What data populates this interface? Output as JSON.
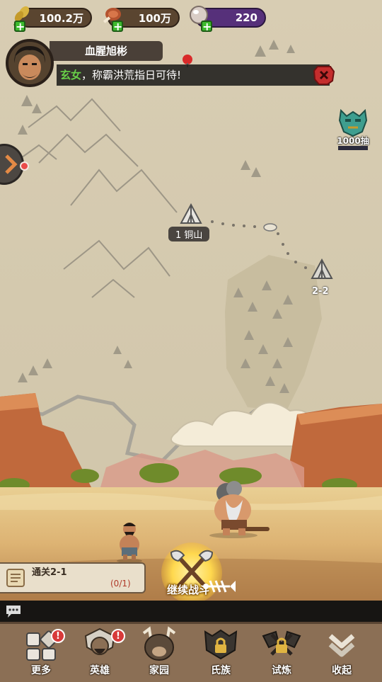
{
  "resources": [
    {
      "icon": "wheat-icon",
      "value": "100.2万"
    },
    {
      "icon": "meat-icon",
      "value": "100万"
    },
    {
      "icon": "gem-icon",
      "value": "220"
    }
  ],
  "profile": {
    "name": "血腥旭彬",
    "announcement_highlight": "玄女",
    "announcement_text": "，称霸洪荒指日可待!"
  },
  "lottery": {
    "label": "1000抽"
  },
  "map": {
    "nodes": [
      {
        "label": "1 铜山"
      },
      {
        "label": "2-2"
      }
    ]
  },
  "quest": {
    "title": "通关2-1",
    "progress": "(0/1)"
  },
  "battle": {
    "label": "继续战斗"
  },
  "nav": [
    {
      "label": "更多",
      "icon": "more-icon",
      "badge": "!"
    },
    {
      "label": "英雄",
      "icon": "hero-icon",
      "badge": "!"
    },
    {
      "label": "家园",
      "icon": "home-icon"
    },
    {
      "label": "氏族",
      "icon": "clan-icon"
    },
    {
      "label": "试炼",
      "icon": "trial-icon"
    },
    {
      "label": "收起",
      "icon": "collapse-icon"
    }
  ],
  "colors": {
    "accent_green": "#68d048",
    "badge_red": "#d83a3a",
    "nav_bg": "#8b6f55"
  }
}
